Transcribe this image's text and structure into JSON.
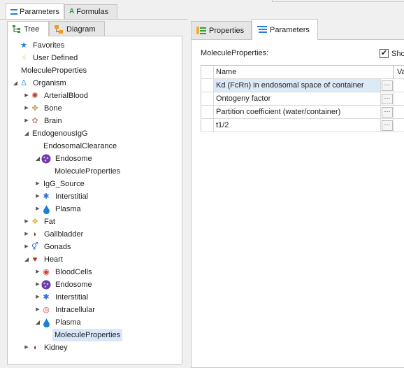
{
  "top_tabs": [
    {
      "label": "Parameters",
      "icon": "parameters-icon",
      "active": true
    },
    {
      "label": "Formulas",
      "icon": "formulas-icon",
      "active": false
    }
  ],
  "left_tabs": [
    {
      "label": "Tree",
      "icon": "tree-icon",
      "active": true
    },
    {
      "label": "Diagram",
      "icon": "diagram-icon",
      "active": false
    }
  ],
  "tree": [
    {
      "label": "Favorites",
      "icon": "star-icon",
      "level": 0,
      "expander": "none"
    },
    {
      "label": "User Defined",
      "icon": "user-hand-icon",
      "level": 0,
      "expander": "none"
    },
    {
      "label": "MoleculeProperties",
      "icon": "",
      "level": 0,
      "expander": "none"
    },
    {
      "label": "Organism",
      "icon": "human-figure-icon",
      "level": 0,
      "expander": "expanded"
    },
    {
      "label": "ArterialBlood",
      "icon": "arterial-blood-icon",
      "level": 1,
      "expander": "collapsed"
    },
    {
      "label": "Bone",
      "icon": "bone-icon",
      "level": 1,
      "expander": "collapsed"
    },
    {
      "label": "Brain",
      "icon": "brain-icon",
      "level": 1,
      "expander": "collapsed"
    },
    {
      "label": "EndogenousIgG",
      "icon": "",
      "level": 1,
      "expander": "expanded"
    },
    {
      "label": "EndosomalClearance",
      "icon": "",
      "level": 2,
      "expander": "none"
    },
    {
      "label": "Endosome",
      "icon": "endosome-icon",
      "level": 2,
      "expander": "expanded"
    },
    {
      "label": "MoleculeProperties",
      "icon": "",
      "level": 3,
      "expander": "none"
    },
    {
      "label": "IgG_Source",
      "icon": "",
      "level": 2,
      "expander": "collapsed"
    },
    {
      "label": "Interstitial",
      "icon": "interstitial-icon",
      "level": 2,
      "expander": "collapsed"
    },
    {
      "label": "Plasma",
      "icon": "plasma-drop-icon",
      "level": 2,
      "expander": "collapsed"
    },
    {
      "label": "Fat",
      "icon": "fat-icon",
      "level": 1,
      "expander": "collapsed"
    },
    {
      "label": "Gallbladder",
      "icon": "gallbladder-icon",
      "level": 1,
      "expander": "collapsed"
    },
    {
      "label": "Gonads",
      "icon": "gonads-icon",
      "level": 1,
      "expander": "collapsed"
    },
    {
      "label": "Heart",
      "icon": "heart-icon",
      "level": 1,
      "expander": "expanded"
    },
    {
      "label": "BloodCells",
      "icon": "blood-cells-icon",
      "level": 2,
      "expander": "collapsed"
    },
    {
      "label": "Endosome",
      "icon": "endosome-icon",
      "level": 2,
      "expander": "collapsed"
    },
    {
      "label": "Interstitial",
      "icon": "interstitial-icon",
      "level": 2,
      "expander": "collapsed"
    },
    {
      "label": "Intracellular",
      "icon": "intracellular-icon",
      "level": 2,
      "expander": "collapsed"
    },
    {
      "label": "Plasma",
      "icon": "plasma-drop-icon",
      "level": 2,
      "expander": "expanded"
    },
    {
      "label": "MoleculeProperties",
      "icon": "",
      "level": 3,
      "expander": "none",
      "selected": true
    },
    {
      "label": "Kidney",
      "icon": "kidney-icon",
      "level": 1,
      "expander": "collapsed"
    }
  ],
  "right_tabs": [
    {
      "label": "Properties",
      "icon": "properties-icon",
      "active": false
    },
    {
      "label": "Parameters",
      "icon": "parameters-list-icon",
      "active": true
    }
  ],
  "right": {
    "container_title": "MoleculeProperties:",
    "show_checkbox_label": "Show",
    "show_checked": true,
    "columns": [
      "Name",
      "Va"
    ],
    "rows": [
      {
        "name": "Kd (FcRn) in endosomal space of container",
        "selected": true
      },
      {
        "name": "Ontogeny factor"
      },
      {
        "name": "Partition coefficient (water/container)"
      },
      {
        "name": "t1/2"
      }
    ],
    "ellipsis": "···"
  }
}
